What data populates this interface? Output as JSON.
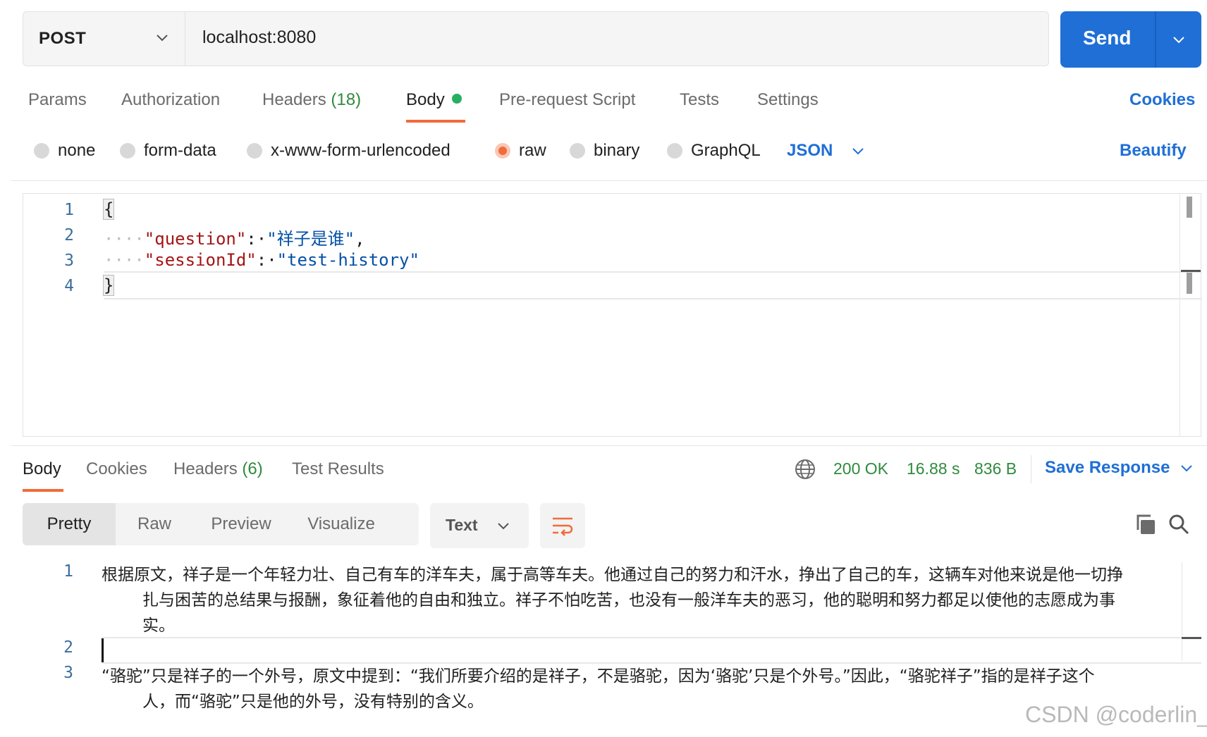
{
  "request": {
    "method": "POST",
    "url": "localhost:8080",
    "send_label": "Send"
  },
  "request_tabs": {
    "params": "Params",
    "authorization": "Authorization",
    "headers": "Headers",
    "headers_count": "(18)",
    "body": "Body",
    "pre_request": "Pre-request Script",
    "tests": "Tests",
    "settings": "Settings",
    "cookies": "Cookies"
  },
  "body_types": {
    "none": "none",
    "form_data": "form-data",
    "urlencoded": "x-www-form-urlencoded",
    "raw": "raw",
    "binary": "binary",
    "graphql": "GraphQL",
    "format": "JSON",
    "beautify": "Beautify"
  },
  "editor": {
    "line_numbers": [
      "1",
      "2",
      "3",
      "4"
    ],
    "open_brace": "{",
    "close_brace": "}",
    "key1": "\"question\"",
    "value1": "\"祥子是谁\"",
    "key2": "\"sessionId\"",
    "value2": "\"test-history\""
  },
  "response_tabs": {
    "body": "Body",
    "cookies": "Cookies",
    "headers": "Headers",
    "headers_count": "(6)",
    "test_results": "Test Results"
  },
  "response_status": {
    "status": "200 OK",
    "time": "16.88 s",
    "size": "836 B",
    "save_response": "Save Response"
  },
  "view_modes": {
    "pretty": "Pretty",
    "raw": "Raw",
    "preview": "Preview",
    "visualize": "Visualize",
    "text_format": "Text"
  },
  "response_body": {
    "line_numbers": [
      "1",
      "2",
      "3"
    ],
    "line1_a": "根据原文，祥子是一个年轻力壮、自己有车的洋车夫，属于高等车夫。他通过自己的努力和汗水，挣出了自己的车，这辆车对他来说是他一切挣",
    "line1_b": "扎与困苦的总结果与报酬，象征着他的自由和独立。祥子不怕吃苦，也没有一般洋车夫的恶习，他的聪明和努力都足以使他的志愿成为事",
    "line1_c": "实。",
    "line3_a": "“骆驼”只是祥子的一个外号，原文中提到：“我们所要介绍的是祥子，不是骆驼，因为‘骆驼’只是个外号。”因此，“骆驼祥子”指的是祥子这个",
    "line3_b": "人，而“骆驼”只是他的外号，没有特别的含义。"
  },
  "watermark": "CSDN @coderlin_",
  "colors": {
    "accent_orange": "#f26b3a",
    "send_blue": "#1f6fd6",
    "status_green": "#2f8a3e"
  }
}
